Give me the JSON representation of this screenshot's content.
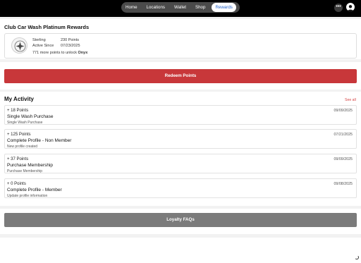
{
  "nav": {
    "items": [
      {
        "label": "Home"
      },
      {
        "label": "Locations"
      },
      {
        "label": "Wallet"
      },
      {
        "label": "Shop"
      },
      {
        "label": "Rewards"
      }
    ],
    "active": "Rewards",
    "more_label": "•••"
  },
  "rewards": {
    "title": "Club Car Wash Platinum Rewards",
    "tier_label": "Sterling",
    "points_value": "230 Points",
    "active_label": "Active Since",
    "active_date": "07/23/2025",
    "unlock_text": "771 more points to unlock",
    "unlock_tier": "Onyx"
  },
  "redeem_button": {
    "label": "Redeem Points"
  },
  "activity": {
    "title": "My Activity",
    "see_all": "See all",
    "items": [
      {
        "points": "+ 18 Points",
        "date": "09/09/2025",
        "name": "Single Wash Purchase",
        "desc": "Single Wash Purchase"
      },
      {
        "points": "+ 125 Points",
        "date": "07/21/2025",
        "name": "Complete Profile - Non Member",
        "desc": "New profile created"
      },
      {
        "points": "+ 37 Points",
        "date": "09/09/2025",
        "name": "Purchase Membership",
        "desc": "Purchase Membership"
      },
      {
        "points": "+ 0 Points",
        "date": "09/08/2025",
        "name": "Complete Profile - Member",
        "desc": "Update profile information"
      }
    ]
  },
  "faq_button": {
    "label": "Loyalty FAQs"
  },
  "colors": {
    "accent_red": "#c8373a",
    "nav_active_text": "#2563c9",
    "faq_gray": "#7b7b7b"
  }
}
